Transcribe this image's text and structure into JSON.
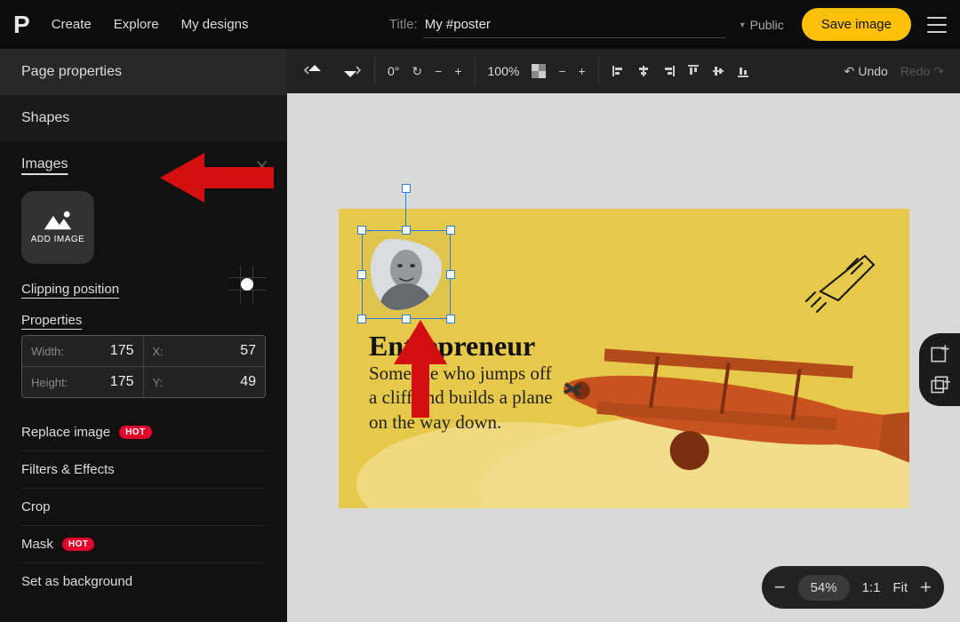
{
  "brand": "P",
  "nav": {
    "create": "Create",
    "explore": "Explore",
    "mydesigns": "My designs"
  },
  "title": {
    "label": "Title:",
    "value": "My #poster"
  },
  "visibility": "Public",
  "save": "Save image",
  "sidebar": {
    "page_properties": "Page properties",
    "shapes": "Shapes",
    "images": "Images",
    "add_image": "ADD IMAGE",
    "clipping": "Clipping position",
    "properties": "Properties",
    "props": {
      "width_label": "Width:",
      "width": "175",
      "height_label": "Height:",
      "height": "175",
      "x_label": "X:",
      "x": "57",
      "y_label": "Y:",
      "y": "49"
    },
    "actions": {
      "replace": "Replace image",
      "filters": "Filters & Effects",
      "crop": "Crop",
      "mask": "Mask",
      "setbg": "Set as background",
      "hot": "HOT"
    }
  },
  "toolbar": {
    "rotation": "0°",
    "zoom": "100%",
    "undo": "Undo",
    "redo": "Redo"
  },
  "poster": {
    "heading": "Entrepreneur",
    "body": "Someone who jumps off a cliff and builds a plane on the way down."
  },
  "zoombar": {
    "value": "54%",
    "ratio": "1:1",
    "fit": "Fit"
  }
}
